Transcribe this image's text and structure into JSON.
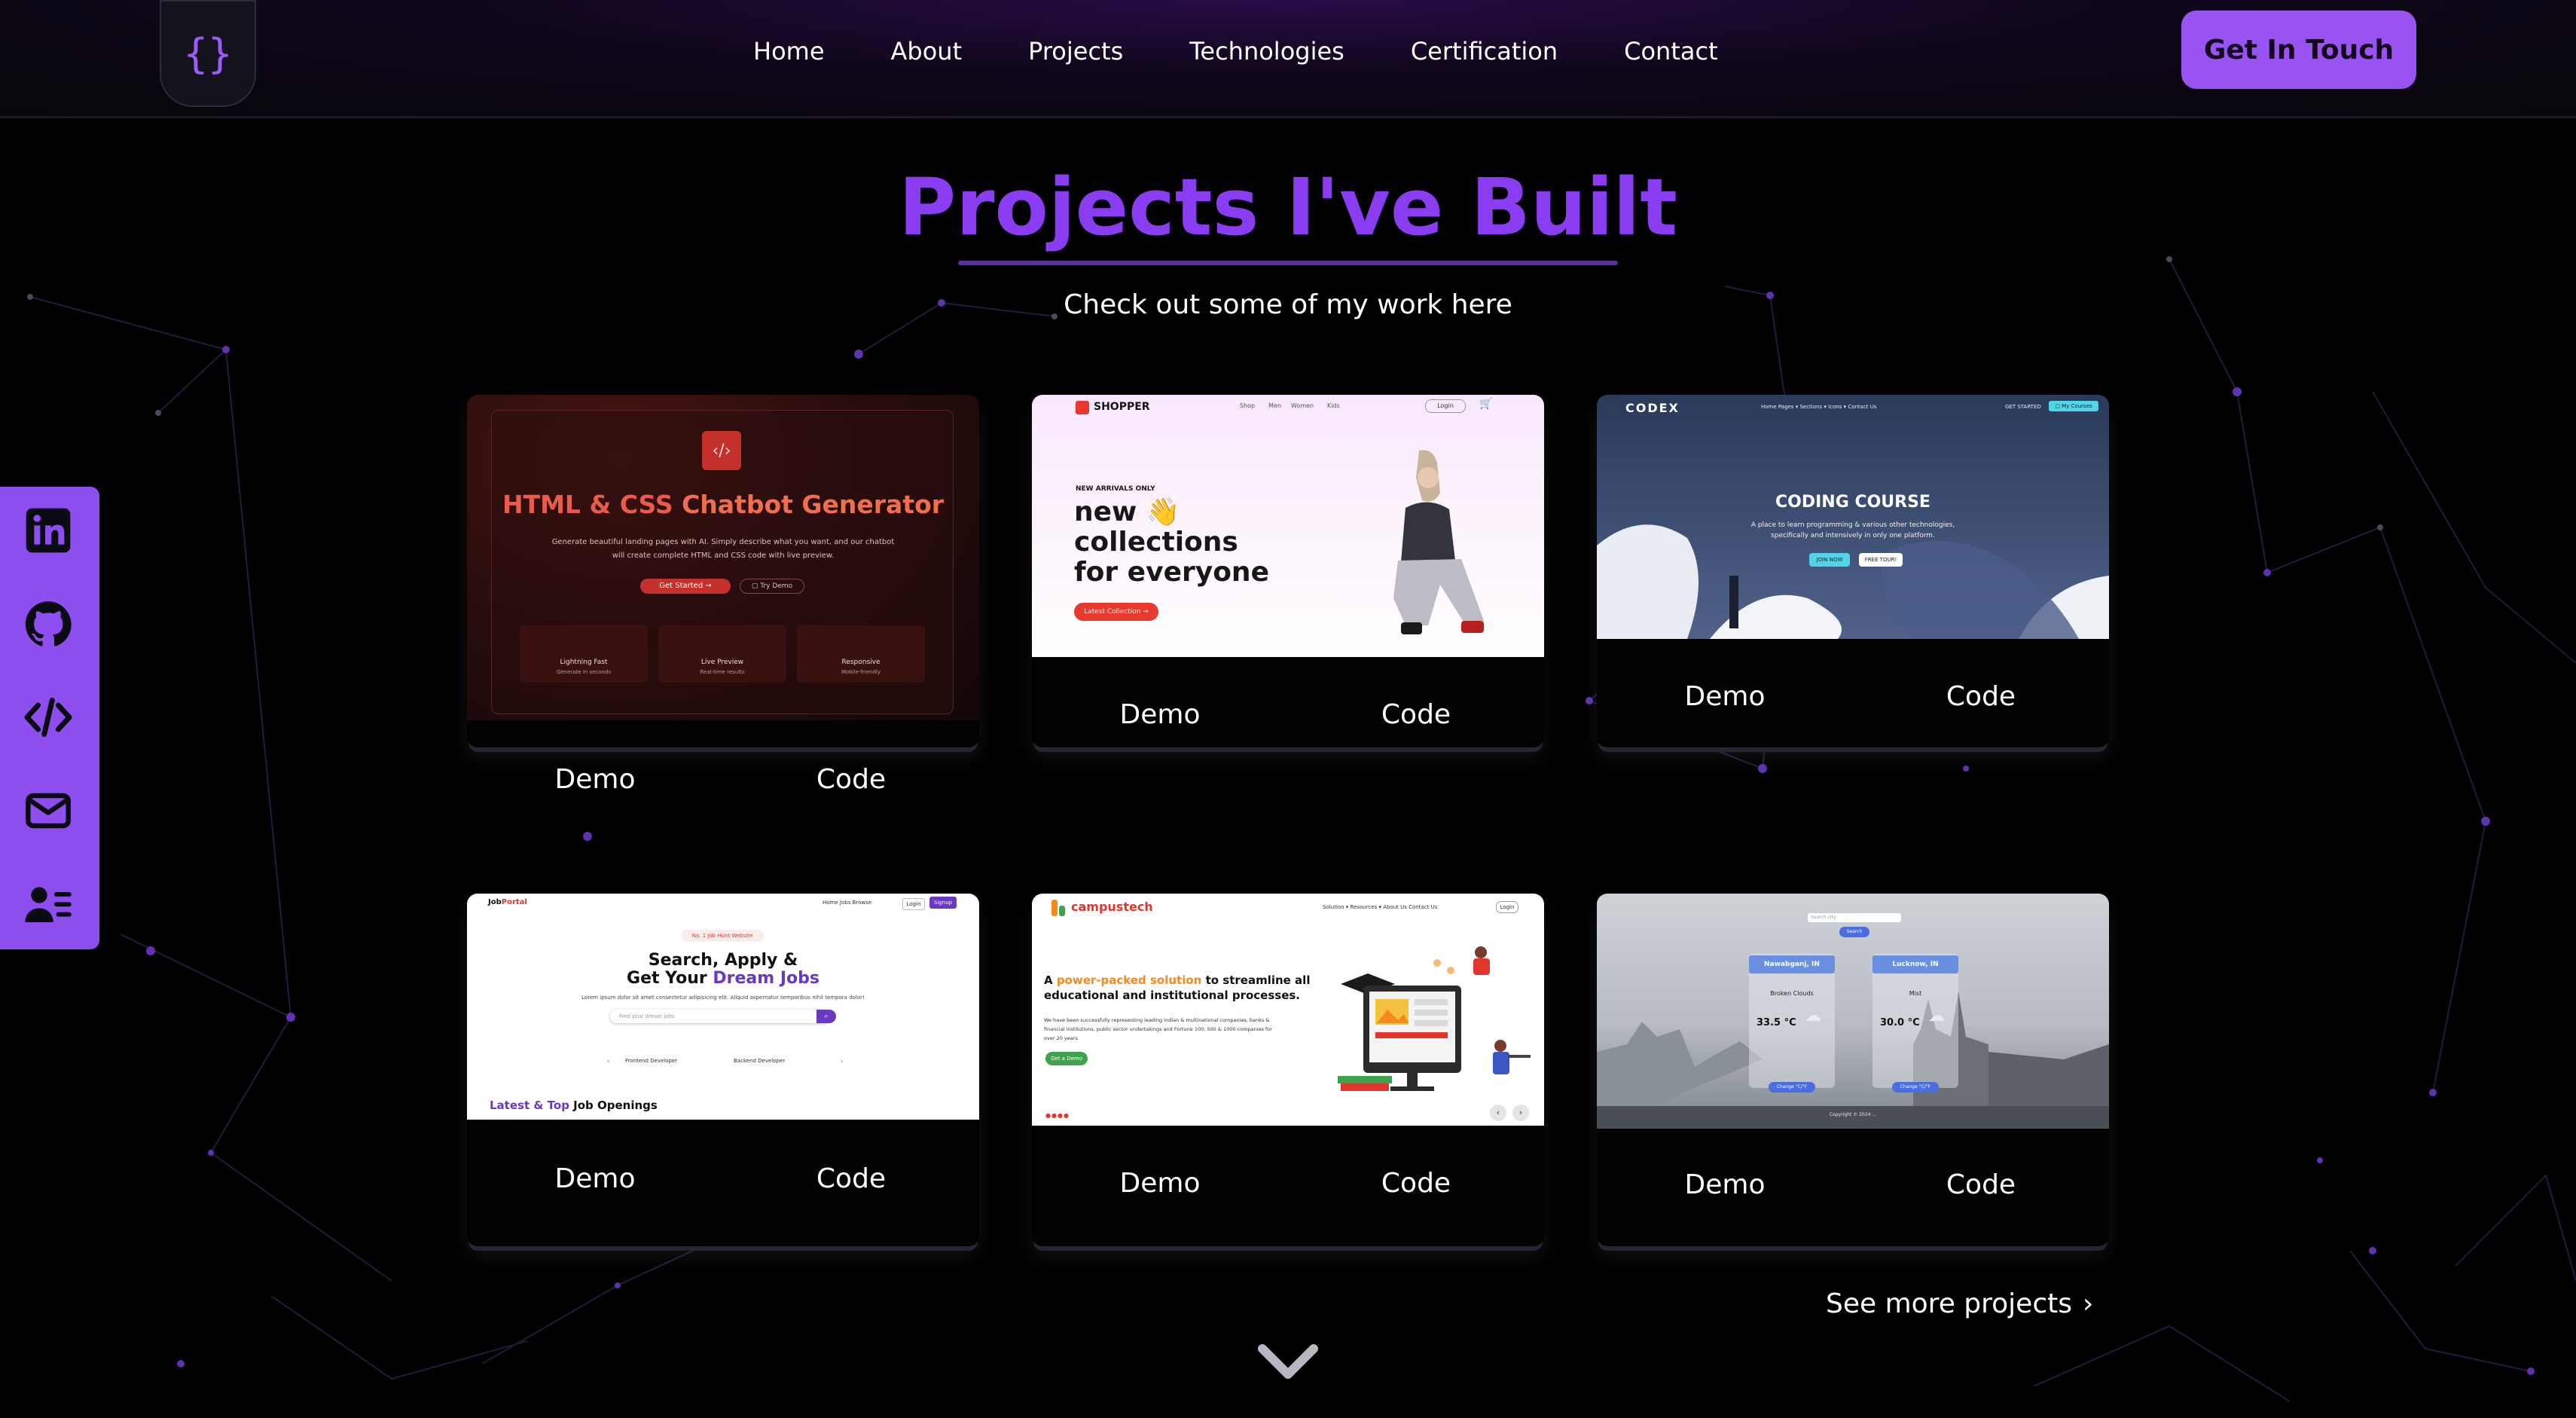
{
  "nav": {
    "logo_glyph": "{}",
    "items": [
      "Home",
      "About",
      "Projects",
      "Technologies",
      "Certification",
      "Contact"
    ],
    "cta": "Get In Touch"
  },
  "hero": {
    "title": "Projects I've Built",
    "subtitle": "Check out some of my work here"
  },
  "social": {
    "items": [
      {
        "icon": "linkedin-icon"
      },
      {
        "icon": "github-icon"
      },
      {
        "icon": "code-icon"
      },
      {
        "icon": "mail-icon"
      },
      {
        "icon": "contact-card-icon"
      }
    ]
  },
  "projects": [
    {
      "demo": "Demo",
      "code": "Code",
      "preview": {
        "headline_a": "HTML & CSS ",
        "headline_b": "Chatbot Generator",
        "line1": "Generate beautiful landing pages with AI. Simply describe what you want, and our chatbot",
        "line2": "will create complete HTML and CSS code with live preview.",
        "btn_primary": "Get Started →",
        "btn_secondary": "▢ Try Demo",
        "features": [
          "Lightning Fast",
          "Live Preview",
          "Responsive"
        ],
        "features_sub": [
          "Generate in seconds",
          "Real-time results",
          "Mobile-friendly"
        ]
      }
    },
    {
      "demo": "Demo",
      "code": "Code",
      "preview": {
        "brand": "SHOPPER",
        "menu": [
          "Shop",
          "Men",
          "Women",
          "Kids"
        ],
        "login": "Login",
        "kicker": "NEW ARRIVALS ONLY",
        "line1": "new 👋",
        "line2": "collections",
        "line3": "for everyone",
        "btn": "Latest Collection →"
      }
    },
    {
      "demo": "Demo",
      "code": "Code",
      "preview": {
        "brand": "CODEX",
        "menu": "Home   Pages ▾   Sections ▾   Icons ▾   Contact Us",
        "get_started": "GET STARTED",
        "my_courses": "▢ My Courses",
        "headline": "CODING COURSE",
        "line1": "A place to learn programming & various other technologies,",
        "line2": "specifically and intensively in only one platform.",
        "btn_primary": "JOIN NOW",
        "btn_secondary": "FREE TOUR!"
      }
    },
    {
      "demo": "Demo",
      "code": "Code",
      "preview": {
        "brand_a": "Job",
        "brand_b": "Portal",
        "menu": "Home   Jobs   Browse",
        "login": "Login",
        "signup": "Signup",
        "badge": "No. 1 Job Hunt Website",
        "headline1": "Search, Apply &",
        "headline2_a": "Get Your ",
        "headline2_b": "Dream Jobs",
        "line1": "Lorem ipsum dolor sit amet consectetur adipisicing elit. Aliquid aspernatur temporibus nihil tempora dolor!",
        "search_placeholder": "Find your dream jobs",
        "cat1": "Frontend Developer",
        "cat2": "Backend Developer",
        "openings_a": "Latest & Top ",
        "openings_b": "Job Openings"
      }
    },
    {
      "demo": "Demo",
      "code": "Code",
      "preview": {
        "brand": "campustech",
        "menu": "Solution ▾     Resources ▾     About Us     Contact Us",
        "login": "Login",
        "headline_a": "A ",
        "headline_b": "power-packed solution",
        "headline_c": " to streamline all",
        "headline2": "educational and institutional processes.",
        "line1": "We have been successfully representing leading Indian & multinational companies, banks &",
        "line2": "financial institutions, public sector undertakings and Fortune 100, 500 & 1000 companies for",
        "line3": "over 20 years.",
        "btn": "Get a Demo"
      }
    },
    {
      "demo": "Demo",
      "code": "Code",
      "preview": {
        "search_placeholder": "Search city",
        "search_btn": "Search",
        "cities": [
          {
            "name": "Nawabganj, IN",
            "desc": "Broken Clouds",
            "temp": "33.5 °C",
            "btn": "Change °C/°F"
          },
          {
            "name": "Lucknow, IN",
            "desc": "Mist",
            "temp": "30.0 °C",
            "btn": "Change °C/°F"
          }
        ],
        "footer": "Copyright © 2024 ..."
      }
    }
  ],
  "see_more": "See more projects",
  "see_more_chevron": "›"
}
